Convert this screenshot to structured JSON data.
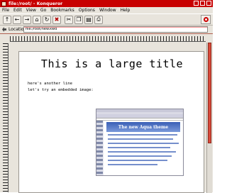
{
  "window": {
    "title": "file:/root/ - Konqueror",
    "accent_color": "#c80000"
  },
  "menubar": {
    "items": [
      "File",
      "Edit",
      "View",
      "Go",
      "Bookmarks",
      "Options",
      "Window",
      "Help"
    ]
  },
  "toolbar": {
    "buttons": [
      "up-arrow-icon",
      "back-arrow-icon",
      "forward-arrow-icon",
      "home-icon",
      "reload-icon",
      "stop-icon",
      "cut-icon",
      "copy-icon",
      "paste-icon",
      "print-icon"
    ]
  },
  "location": {
    "label": "Location:",
    "value": "file:/root/new.kwd"
  },
  "document": {
    "title": "This is a large title",
    "line1": "here's another line",
    "line2": "let's try an embedded image:",
    "embedded_heading": "The new Aqua theme"
  }
}
